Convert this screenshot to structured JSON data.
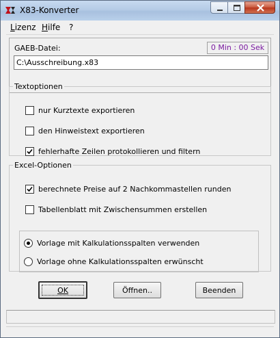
{
  "window": {
    "title": "X83-Konverter"
  },
  "menu": {
    "items": [
      {
        "label": "Lizenz",
        "mnemonic": "L",
        "rest": "izenz"
      },
      {
        "label": "Hilfe",
        "mnemonic": "H",
        "rest": "ilfe"
      },
      {
        "label": "?"
      }
    ]
  },
  "gaeb": {
    "label": "GAEB-Datei:",
    "timer": "0 Min : 00 Sek",
    "file_path": "C:\\Ausschreibung.x83"
  },
  "textoptionen": {
    "legend": "Textoptionen",
    "options": [
      {
        "label": "nur Kurztexte exportieren",
        "checked": false
      },
      {
        "label": "den Hinweistext exportieren",
        "checked": false
      },
      {
        "label": "fehlerhafte Zeilen protokollieren und filtern",
        "checked": true
      }
    ]
  },
  "excel": {
    "legend": "Excel-Optionen",
    "options": [
      {
        "label": "berechnete Preise auf 2 Nachkommastellen runden",
        "checked": true
      },
      {
        "label": "Tabellenblatt mit Zwischensummen erstellen",
        "checked": false
      }
    ],
    "radios": [
      {
        "label": "Vorlage mit Kalkulationsspalten verwenden",
        "selected": true
      },
      {
        "label": "Vorlage ohne Kalkulationsspalten erwünscht",
        "selected": false
      }
    ]
  },
  "buttons": {
    "ok": "OK",
    "open": "Öffnen..",
    "quit": "Beenden"
  },
  "colors": {
    "timer_text": "#7a1aa0",
    "title_bar": "#b5cbe6",
    "close_button": "#c8573c"
  }
}
